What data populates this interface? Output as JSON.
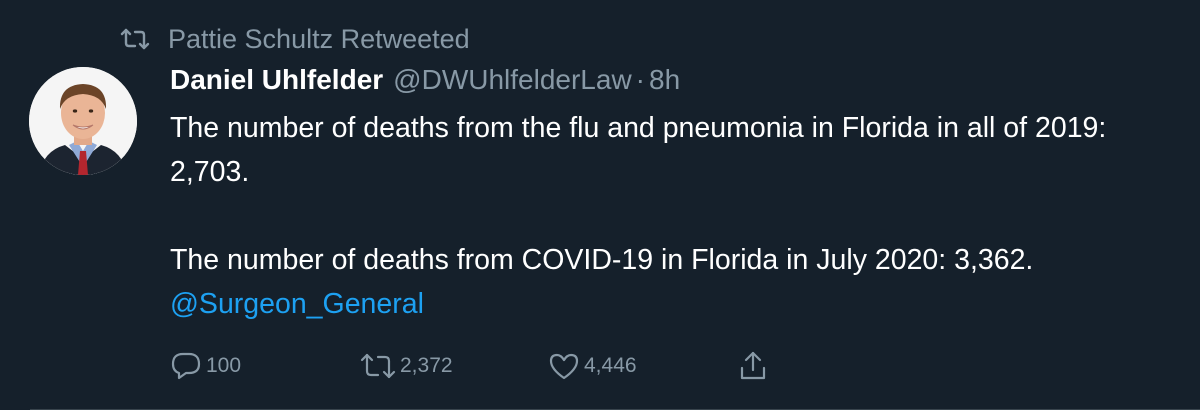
{
  "retweet": {
    "icon": "retweet-icon",
    "label": "Pattie Schultz Retweeted"
  },
  "author": {
    "display_name": "Daniel Uhlfelder",
    "handle": "@DWUhlfelderLaw",
    "separator": "·",
    "time": "8h",
    "avatar": "avatar-photo"
  },
  "tweet": {
    "paragraphs": [
      "The number of deaths from the flu and pneumonia in Florida in all of 2019: 2,703.",
      "The number of deaths from COVID-19 in Florida in July 2020: 3,362."
    ],
    "mention": "@Surgeon_General"
  },
  "actions": {
    "reply": {
      "icon": "reply-icon",
      "count": "100"
    },
    "retweet": {
      "icon": "retweet-icon",
      "count": "2,372"
    },
    "like": {
      "icon": "heart-icon",
      "count": "4,446"
    },
    "share": {
      "icon": "share-icon"
    }
  },
  "colors": {
    "background": "#15202b",
    "text": "#ffffff",
    "secondary": "#8899a6",
    "link": "#1da1f2"
  }
}
